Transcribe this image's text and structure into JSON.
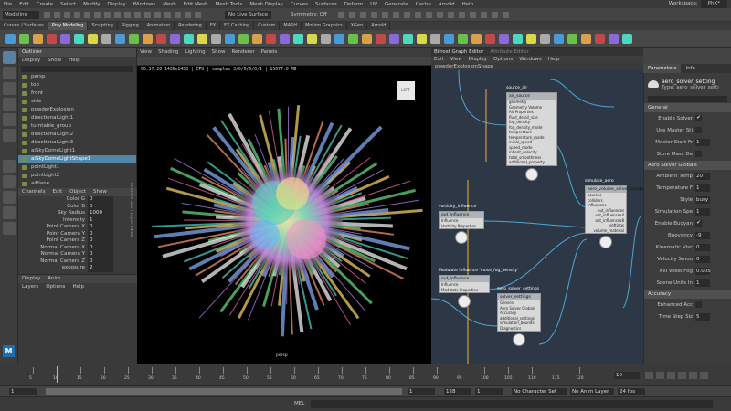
{
  "menubar": {
    "items": [
      "File",
      "Edit",
      "Create",
      "Select",
      "Modify",
      "Display",
      "Windows",
      "Mesh",
      "Edit Mesh",
      "Mesh Tools",
      "Mesh Display",
      "Curves",
      "Surfaces",
      "Deform",
      "UV",
      "Generate",
      "Cache",
      "Arnold",
      "Help"
    ],
    "workspace_label": "Workspace:",
    "workspace_value": "PhX*"
  },
  "toolbar": {
    "mode": "Modeling",
    "live_surface": "No Live Surface",
    "symmetry": "Symmetry: Off"
  },
  "shelf_tabs": [
    "Curves / Surfaces",
    "Poly Modeling",
    "Sculpting",
    "Rigging",
    "Animation",
    "Rendering",
    "FX",
    "FX Caching",
    "Custom",
    "MASH",
    "Motion Graphics",
    "XGen",
    "Arnold"
  ],
  "outliner": {
    "title": "Outliner",
    "menu": [
      "Display",
      "Show",
      "Help"
    ],
    "items": [
      {
        "label": "persp",
        "sel": false
      },
      {
        "label": "top",
        "sel": false
      },
      {
        "label": "front",
        "sel": false
      },
      {
        "label": "side",
        "sel": false
      },
      {
        "label": "powderExplosion",
        "sel": false
      },
      {
        "label": "directionalLight1",
        "sel": false
      },
      {
        "label": "turntable_group",
        "sel": false
      },
      {
        "label": "directionalLight2",
        "sel": false
      },
      {
        "label": "directionalLight3",
        "sel": false
      },
      {
        "label": "aiSkyDomeLight1",
        "sel": false
      },
      {
        "label": "aiSkyDomeLightShape1",
        "sel": true
      },
      {
        "label": "pointLight1",
        "sel": false
      },
      {
        "label": "pointLight2",
        "sel": false
      },
      {
        "label": "aiPlane",
        "sel": false
      },
      {
        "label": "persp1",
        "sel": false
      },
      {
        "label": "aiCube1",
        "sel": false
      },
      {
        "label": "pointLight3",
        "sel": false
      }
    ]
  },
  "channels": {
    "menu": [
      "Channels",
      "Edit",
      "Object",
      "Show"
    ],
    "rows": [
      {
        "label": "Color G",
        "value": "0"
      },
      {
        "label": "Color B",
        "value": "0"
      },
      {
        "label": "Sky Radius",
        "value": "1000"
      },
      {
        "label": "Intensity",
        "value": "1"
      },
      {
        "label": "Point Camera X",
        "value": "0"
      },
      {
        "label": "Point Camera Y",
        "value": "0"
      },
      {
        "label": "Point Camera Z",
        "value": "0"
      },
      {
        "label": "Normal Camera X",
        "value": "0"
      },
      {
        "label": "Normal Camera Y",
        "value": "0"
      },
      {
        "label": "Normal Camera Z",
        "value": "0"
      },
      {
        "label": "exposure",
        "value": "2"
      }
    ]
  },
  "display_panel": {
    "tabs": [
      "Display",
      "Anim"
    ],
    "menu": [
      "Layers",
      "Options",
      "Help"
    ]
  },
  "viewport": {
    "menu": [
      "View",
      "Shading",
      "Lighting",
      "Show",
      "Renderer",
      "Panels"
    ],
    "hud": "00:17:26 1436x1458 | CPU | samples 3/0/0/0/0/1 | 15077.0 MB",
    "camera": "persp",
    "cube_label": "LEFT",
    "side_tabs": [
      "Channel Box / Layer Editor",
      "Modeling Toolkit"
    ]
  },
  "bifrost": {
    "title": "Bifrost Graph Editor",
    "subtitle": "Attribute Editor",
    "menu": [
      "Edit",
      "View",
      "Display",
      "Options",
      "Windows",
      "Help"
    ],
    "tab": "powderExplosionShape",
    "nodes": [
      {
        "title": "source_air",
        "header": "air_source",
        "ports_in": [
          "geometry",
          "Geometry Volume",
          "Air Properties",
          "fluid_detail_size",
          "fog_density",
          "fog_density_mode",
          "temperature",
          "temperature_mode",
          "initial_speed",
          "speed_mode",
          "inherit_velocity",
          "total_smoothness",
          "additional_property"
        ],
        "ports_out": []
      },
      {
        "title": "simulate_aero",
        "header": "aero_volume_solver_inputs",
        "ports_in": [
          "sources",
          "colliders",
          "influences"
        ],
        "ports_out": [
          "out_influences",
          "out_influences4",
          "out_influences8",
          "settings",
          "volume_material"
        ]
      },
      {
        "title": "vorticity_influence",
        "header": "out_influence",
        "ports_in": [
          "Influence",
          "Vorticity Properties"
        ],
        "ports_out": []
      },
      {
        "title": "Modulate influence 'mose_fog_density'",
        "header": "out_influence",
        "ports_in": [
          "Influence",
          "Modulate Properties"
        ],
        "ports_out": []
      },
      {
        "title": "aero_solver_settings",
        "header": "solver_settings",
        "ports_in": [
          "General",
          "Aero Solver Globals",
          "Accuracy",
          "additional_settings",
          "simulation_bounds",
          "Diagnostics"
        ],
        "ports_out": []
      }
    ]
  },
  "params": {
    "tabs": [
      "Parameters",
      "Info"
    ],
    "node_name": "aero_solver_setting",
    "node_type": "Type: aero_solver_setti",
    "sections": [
      {
        "title": "General",
        "rows": [
          {
            "label": "Enable Solver",
            "value": "✔",
            "kind": "check"
          },
          {
            "label": "Use Master Sti",
            "value": "",
            "kind": "check"
          },
          {
            "label": "Master Start Fr",
            "value": "1",
            "kind": "num"
          },
          {
            "label": "Store Mass De",
            "value": "",
            "kind": "check"
          }
        ]
      },
      {
        "title": "Aero Solver Globals",
        "rows": [
          {
            "label": "Ambient Temp",
            "value": "20",
            "kind": "num"
          },
          {
            "label": "Temperature F",
            "value": "1",
            "kind": "num"
          },
          {
            "label": "Style",
            "value": "busy",
            "kind": "num"
          },
          {
            "label": "Simulation Spe",
            "value": "1",
            "kind": "num"
          },
          {
            "label": "Enable Buoyan",
            "value": "✔",
            "kind": "check"
          },
          {
            "label": "Buoyancy",
            "value": "-9",
            "kind": "num"
          },
          {
            "label": "Kinematic Visc",
            "value": "0",
            "kind": "num"
          },
          {
            "label": "Velocity Smoo",
            "value": "0",
            "kind": "num"
          },
          {
            "label": "Kill Voxel Fog",
            "value": "0.005",
            "kind": "num"
          },
          {
            "label": "Scene Units In",
            "value": "1",
            "kind": "num"
          }
        ]
      },
      {
        "title": "Accuracy",
        "rows": [
          {
            "label": "Enhanced Acc",
            "value": "",
            "kind": "check"
          },
          {
            "label": "Time Step Siz",
            "value": "5",
            "kind": "num"
          }
        ]
      }
    ]
  },
  "timeline": {
    "ticks": [
      "5",
      "10",
      "15",
      "20",
      "25",
      "30",
      "35",
      "40",
      "45",
      "50",
      "55",
      "60",
      "65",
      "70",
      "75",
      "80",
      "85",
      "90",
      "95",
      "100",
      "105",
      "110",
      "115",
      "120"
    ],
    "current": "10"
  },
  "range": {
    "start": "1",
    "start_inner": "1",
    "end_inner": "128",
    "end": "1",
    "char_set": "No Character Set",
    "anim_layer": "No Anim Layer",
    "fps": "24 fps"
  },
  "cmdline": {
    "label": "MEL"
  },
  "colors": {
    "selection": "#5285a6",
    "viewport_bg": "#000000",
    "graph_bg": "#2d3745",
    "wire": "#4aa8d8",
    "accent": "#f0b030"
  }
}
